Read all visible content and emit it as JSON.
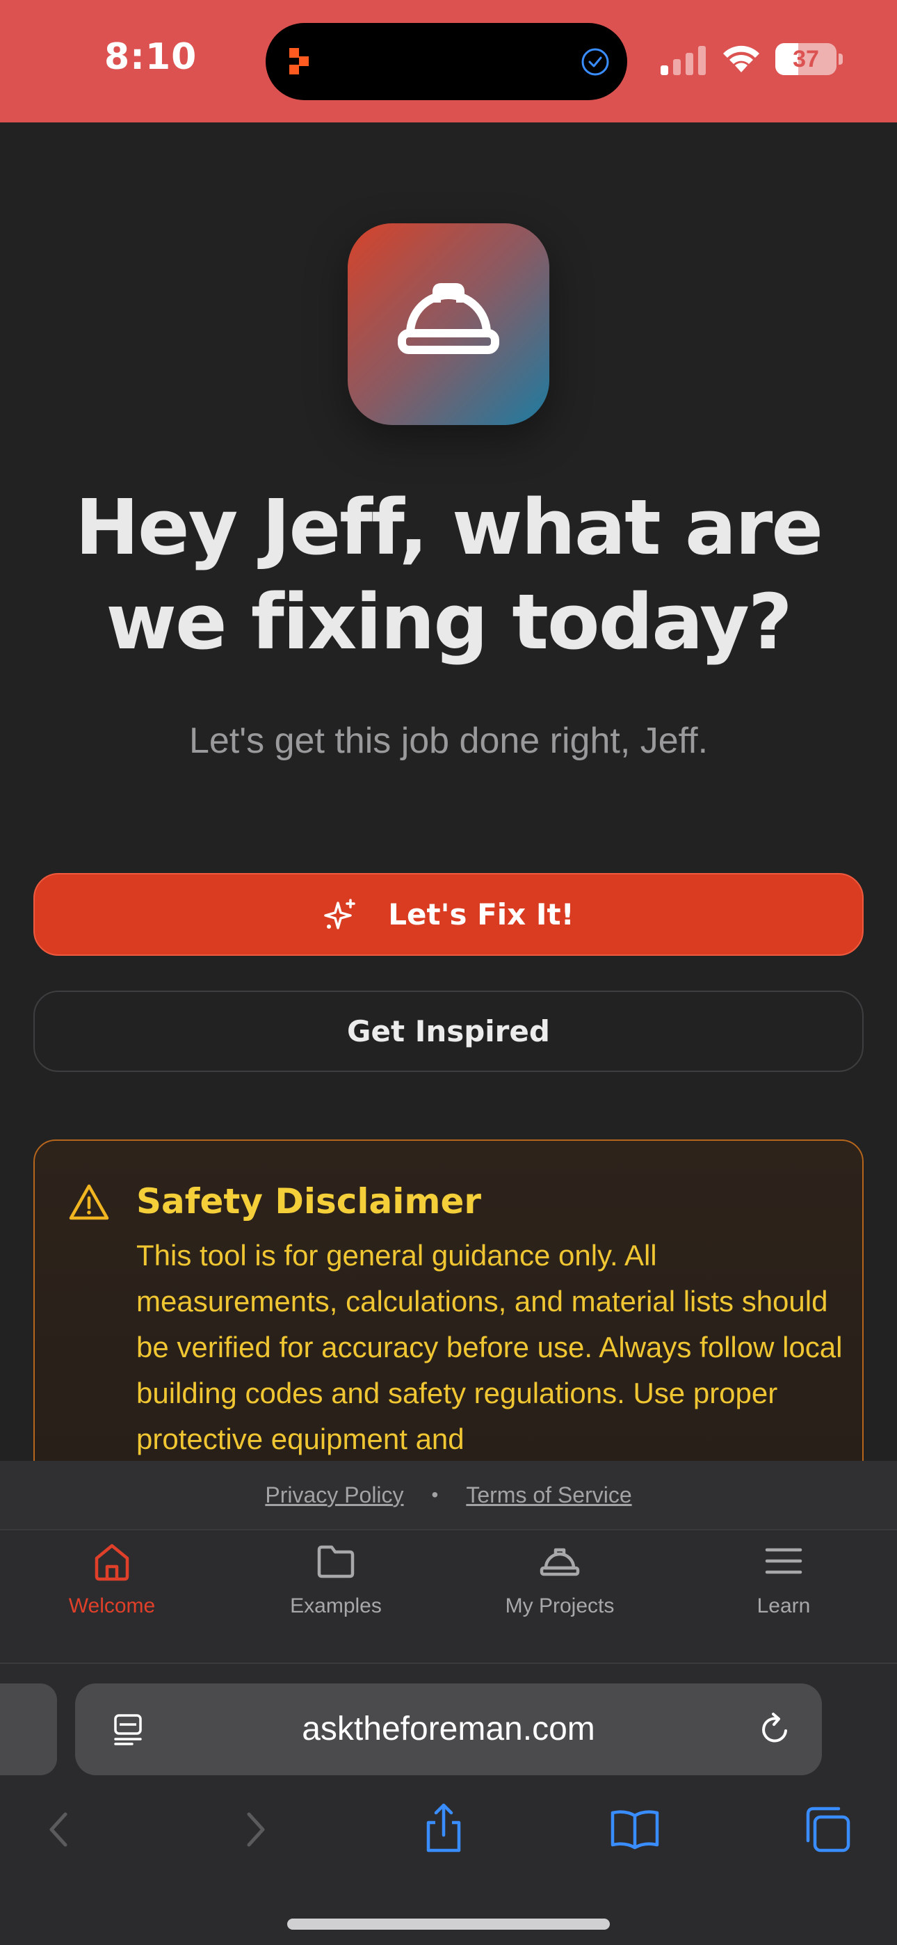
{
  "status_bar": {
    "time": "8:10",
    "battery_level": 37,
    "battery_label": "37",
    "bg_color": "#dc5250"
  },
  "app": {
    "icon": "hard-hat-icon",
    "headline": "Hey Jeff, what are we fixing today?",
    "subtitle": "Let's get this job done right, Jeff."
  },
  "actions": {
    "primary_label": "Let's Fix It!",
    "primary_icon": "sparkles-icon",
    "secondary_label": "Get Inspired",
    "accent_color": "#d93c21"
  },
  "disclaimer": {
    "icon": "warning-triangle-icon",
    "title": "Safety Disclaimer",
    "text": "This tool is for general guidance only. All measurements, calculations, and material lists should be verified for accuracy before use. Always follow local building codes and safety regulations. Use proper protective equipment and"
  },
  "footer_links": {
    "privacy": "Privacy Policy",
    "separator": "•",
    "terms": "Terms of Service"
  },
  "tabs": [
    {
      "label": "Welcome",
      "icon": "home-icon",
      "active": true
    },
    {
      "label": "Examples",
      "icon": "folder-icon",
      "active": false
    },
    {
      "label": "My Projects",
      "icon": "hard-hat-icon",
      "active": false
    },
    {
      "label": "Learn",
      "icon": "menu-icon",
      "active": false
    }
  ],
  "browser": {
    "url": "asktheforeman.com",
    "reader_icon": "reader-icon",
    "reload_icon": "reload-icon",
    "toolbar": [
      "back-icon",
      "forward-icon",
      "share-icon",
      "bookmarks-icon",
      "tabs-icon"
    ]
  }
}
